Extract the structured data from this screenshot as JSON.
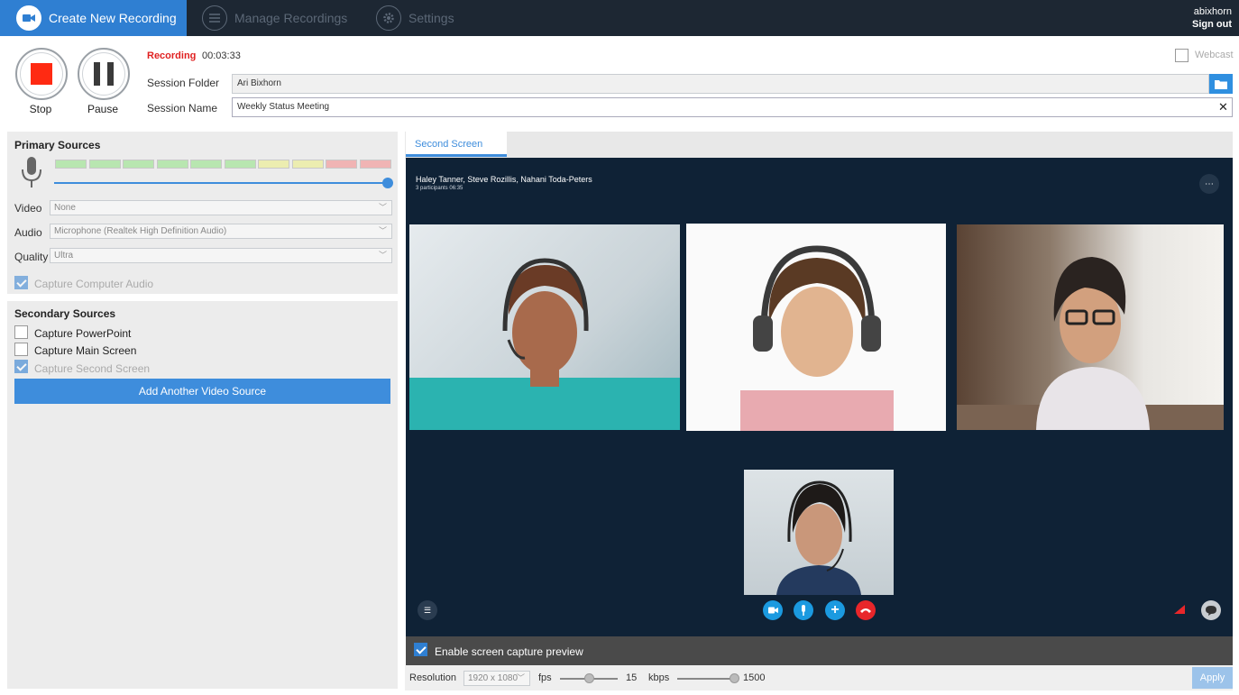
{
  "tabs": [
    {
      "label": "Create New Recording",
      "icon": "video-camera-icon"
    },
    {
      "label": "Manage Recordings",
      "icon": "list-icon"
    },
    {
      "label": "Settings",
      "icon": "gear-icon"
    }
  ],
  "user": {
    "name": "abixhorn",
    "sign_out": "Sign out"
  },
  "controls": {
    "stop": "Stop",
    "pause": "Pause"
  },
  "recording": {
    "status": "Recording",
    "time": "00:03:33"
  },
  "session": {
    "folder_label": "Session Folder",
    "folder_value": "Ari Bixhorn",
    "name_label": "Session Name",
    "name_value": "Weekly Status Meeting"
  },
  "webcast": {
    "label": "Webcast",
    "checked": false
  },
  "primary": {
    "title": "Primary Sources",
    "video_label": "Video",
    "video_value": "None",
    "audio_label": "Audio",
    "audio_value": "Microphone (Realtek High Definition Audio)",
    "quality_label": "Quality",
    "quality_value": "Ultra",
    "capture_audio": "Capture Computer Audio",
    "meter_colors": [
      "#b8e6b0",
      "#b8e6b0",
      "#b8e6b0",
      "#b8e6b0",
      "#b8e6b0",
      "#b8e6b0",
      "#ecedb0",
      "#ecedb0",
      "#f0b4b4",
      "#f0b4b4"
    ]
  },
  "secondary": {
    "title": "Secondary Sources",
    "items": [
      {
        "label": "Capture PowerPoint",
        "checked": false
      },
      {
        "label": "Capture Main Screen",
        "checked": false
      },
      {
        "label": "Capture Second Screen",
        "checked": true
      }
    ],
    "add_button": "Add Another Video Source"
  },
  "preview": {
    "tab": "Second Screen",
    "call_names": "Haley Tanner, Steve Rozillis, Nahani Toda-Peters",
    "call_info": "3 participants 06:35",
    "enable_preview": "Enable screen capture preview"
  },
  "bottom": {
    "resolution_label": "Resolution",
    "resolution_value": "1920 x 1080",
    "fps_label": "fps",
    "fps_value": "15",
    "kbps_label": "kbps",
    "kbps_value": "1500",
    "apply": "Apply"
  },
  "colors": {
    "accent": "#2f7fd2",
    "topbar": "#1d2733",
    "recording": "#e02020",
    "hangup": "#e8262a"
  }
}
